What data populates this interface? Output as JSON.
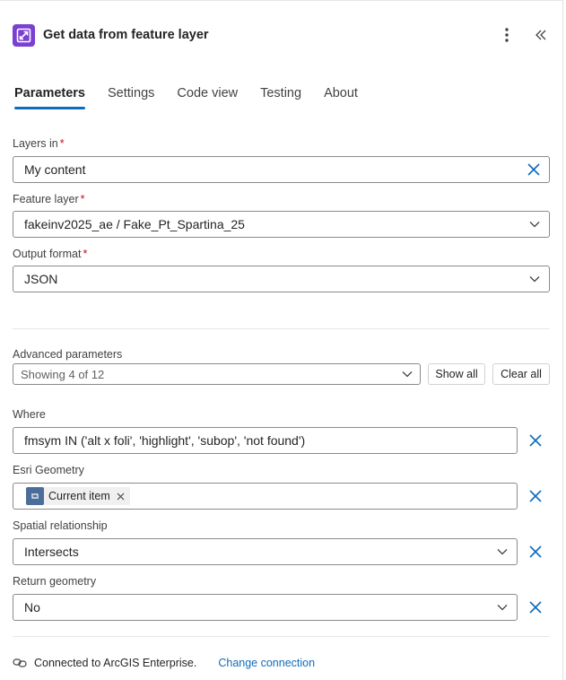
{
  "header": {
    "title": "Get data from feature layer",
    "accent": "#7b3fd1"
  },
  "tabs": [
    {
      "label": "Parameters",
      "active": true
    },
    {
      "label": "Settings"
    },
    {
      "label": "Code view"
    },
    {
      "label": "Testing"
    },
    {
      "label": "About"
    }
  ],
  "fields": {
    "layers_in": {
      "label": "Layers in",
      "required": "*",
      "value": "My content"
    },
    "feature_layer": {
      "label": "Feature layer",
      "required": "*",
      "value": "fakeinv2025_ae / Fake_Pt_Spartina_25"
    },
    "output_format": {
      "label": "Output format",
      "required": "*",
      "value": "JSON"
    }
  },
  "advanced": {
    "label": "Advanced parameters",
    "summary": "Showing 4 of 12",
    "show_all": "Show all",
    "clear_all": "Clear all"
  },
  "params": {
    "where": {
      "label": "Where",
      "value": "fmsym IN ('alt x foli', 'highlight', 'subop', 'not found')"
    },
    "esri_geometry": {
      "label": "Esri Geometry",
      "token": "Current item"
    },
    "spatial_relationship": {
      "label": "Spatial relationship",
      "value": "Intersects"
    },
    "return_geometry": {
      "label": "Return geometry",
      "value": "No"
    }
  },
  "footer": {
    "status": "Connected to ArcGIS Enterprise.",
    "change_link": "Change connection"
  },
  "colors": {
    "link_blue": "#0f6cbd",
    "required_red": "#c50f1f"
  }
}
